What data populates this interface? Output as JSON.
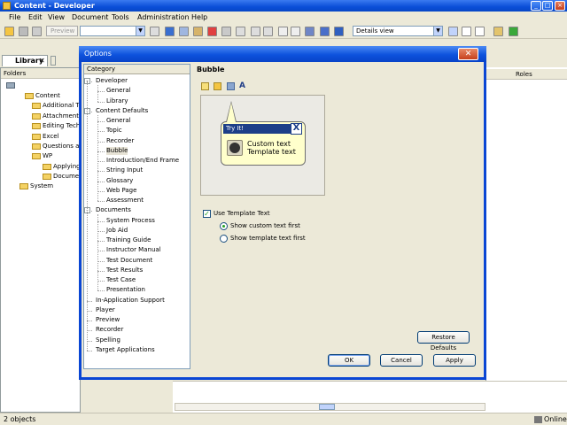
{
  "window": {
    "title": "Content - Developer"
  },
  "menu": [
    "File",
    "Edit",
    "View",
    "Document",
    "Tools",
    "Administration",
    "Help"
  ],
  "toolbar": {
    "preview_label": "Preview",
    "view_select": "Details view"
  },
  "library": {
    "tab_label": "Library",
    "folders_header": "Folders",
    "tree": [
      "Content",
      "Additional Top",
      "Attachments",
      "Editing Techn",
      "Excel",
      "Questions an",
      "WP",
      "Applying",
      "Docume",
      "System"
    ],
    "roles_header": "Roles"
  },
  "status": {
    "count": "2 objects",
    "mode": "Online"
  },
  "dialog": {
    "title": "Options",
    "category_header": "Category",
    "section_title": "Bubble",
    "tree": [
      {
        "label": "Developer",
        "level": 0,
        "exp": "-"
      },
      {
        "label": "General",
        "level": 1
      },
      {
        "label": "Library",
        "level": 1
      },
      {
        "label": "Content Defaults",
        "level": 0,
        "exp": "-"
      },
      {
        "label": "General",
        "level": 1
      },
      {
        "label": "Topic",
        "level": 1
      },
      {
        "label": "Recorder",
        "level": 1
      },
      {
        "label": "Bubble",
        "level": 1,
        "selected": true
      },
      {
        "label": "Introduction/End Frame",
        "level": 1
      },
      {
        "label": "String Input",
        "level": 1
      },
      {
        "label": "Glossary",
        "level": 1
      },
      {
        "label": "Web Page",
        "level": 1
      },
      {
        "label": "Assessment",
        "level": 1
      },
      {
        "label": "Documents",
        "level": 0,
        "exp": "-"
      },
      {
        "label": "System Process",
        "level": 1
      },
      {
        "label": "Job Aid",
        "level": 1
      },
      {
        "label": "Training Guide",
        "level": 1
      },
      {
        "label": "Instructor Manual",
        "level": 1
      },
      {
        "label": "Test Document",
        "level": 1
      },
      {
        "label": "Test Results",
        "level": 1
      },
      {
        "label": "Test Case",
        "level": 1
      },
      {
        "label": "Presentation",
        "level": 1
      },
      {
        "label": "In-Application Support",
        "level": 0
      },
      {
        "label": "Player",
        "level": 0
      },
      {
        "label": "Preview",
        "level": 0
      },
      {
        "label": "Recorder",
        "level": 0
      },
      {
        "label": "Spelling",
        "level": 0
      },
      {
        "label": "Target Applications",
        "level": 0
      }
    ],
    "bubble": {
      "header": "Try It!",
      "close": "X",
      "line1": "Custom text",
      "line2": "Template text"
    },
    "use_template_text": {
      "label": "Use Template Text",
      "checked": true
    },
    "radio_custom_first": {
      "label": "Show custom text first",
      "selected": true
    },
    "radio_template_first": {
      "label": "Show template text first",
      "selected": false
    },
    "buttons": {
      "restore": "Restore Defaults",
      "ok": "OK",
      "cancel": "Cancel",
      "apply": "Apply"
    }
  },
  "colors": {
    "titlebar": "#0a4ed8",
    "bubble_fill": "#ffffcc",
    "bubble_header": "#1d3f88"
  }
}
